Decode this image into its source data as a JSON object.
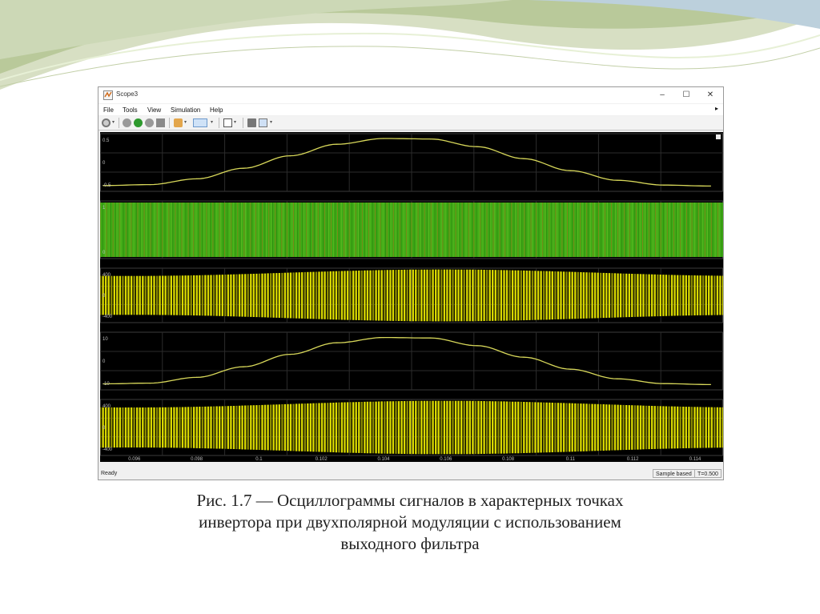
{
  "window": {
    "title": "Scope3",
    "controls": [
      "–",
      "☐",
      "✕"
    ]
  },
  "menu": [
    "File",
    "Tools",
    "View",
    "Simulation",
    "Help"
  ],
  "toolbar": {
    "icons": [
      "gear-icon",
      "stop-icon",
      "run-icon",
      "step-icon",
      "stop-square-icon",
      "highlight-icon",
      "cursor-measure-icon",
      "zoom-fit-icon",
      "autoscale-icon",
      "edit-icon"
    ]
  },
  "chart_data": [
    {
      "type": "line",
      "name": "reference",
      "x": [
        0.095,
        0.0965,
        0.098,
        0.0995,
        0.101,
        0.1025,
        0.104,
        0.1055,
        0.107,
        0.1085,
        0.11,
        0.1115,
        0.113,
        0.1145
      ],
      "y": [
        -0.48,
        -0.46,
        -0.34,
        -0.12,
        0.14,
        0.38,
        0.5,
        0.49,
        0.33,
        0.08,
        -0.17,
        -0.37,
        -0.47,
        -0.49
      ],
      "yticks": [
        "0.5",
        "0",
        "-0.5"
      ],
      "ylim": [
        -0.6,
        0.6
      ],
      "color": "#d8d85a"
    },
    {
      "type": "area",
      "name": "pwm-carrier",
      "yticks": [
        "1",
        "0"
      ],
      "ylim": [
        -0.1,
        1.1
      ],
      "color": "#3faa16"
    },
    {
      "type": "area",
      "name": "inverter-voltage",
      "envelope_min": [
        300,
        330,
        400
      ],
      "yticks": [
        "400",
        "0",
        "-400"
      ],
      "ylim": [
        -420,
        420
      ],
      "color": "#d9d900"
    },
    {
      "type": "line",
      "name": "filtered-output",
      "x": [
        0.095,
        0.0965,
        0.098,
        0.0995,
        0.101,
        0.1025,
        0.104,
        0.1055,
        0.107,
        0.1085,
        0.11,
        0.1115,
        0.113,
        0.1145
      ],
      "y": [
        -9.5,
        -9.2,
        -6.8,
        -2.4,
        2.8,
        7.6,
        9.8,
        9.6,
        6.4,
        1.6,
        -3.4,
        -7.4,
        -9.4,
        -9.8
      ],
      "yticks": [
        "10",
        "0",
        "-10"
      ],
      "ylim": [
        -12,
        12
      ],
      "color": "#d8d85a"
    },
    {
      "type": "area",
      "name": "inverter-voltage-2",
      "yticks": [
        "400",
        "0",
        "-400"
      ],
      "ylim": [
        -420,
        420
      ],
      "color": "#d9d900"
    }
  ],
  "xaxis": {
    "ticks": [
      "0.096",
      "0.098",
      "0.1",
      "0.102",
      "0.104",
      "0.106",
      "0.108",
      "0.11",
      "0.112",
      "0.114"
    ],
    "xlim": [
      0.0949,
      0.1149
    ]
  },
  "status": {
    "text": "Ready",
    "sample": "Sample based",
    "time": "T=0.500"
  },
  "caption": [
    "Рис. 1.7 — Осциллограммы сигналов в характерных точках",
    "инвертора при двухполярной модуляции с использованием",
    "выходного фильтра"
  ]
}
